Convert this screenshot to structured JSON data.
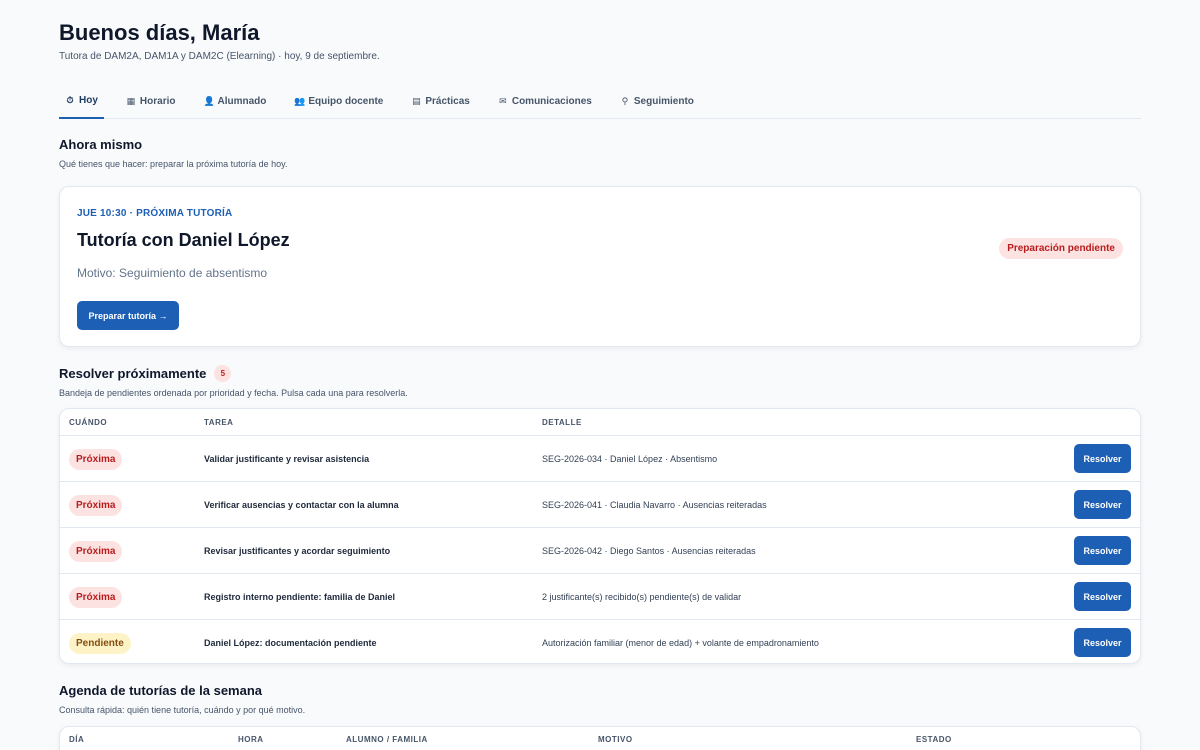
{
  "header": {
    "greeting": "Buenos días, María",
    "subtitle": "Tutora de DAM2A, DAM1A y DAM2C (Elearning) · hoy, 9 de septiembre."
  },
  "tabs": [
    {
      "label": "Hoy",
      "icon": "clock-icon",
      "glyph": "⏱",
      "active": true
    },
    {
      "label": "Horario",
      "icon": "calendar-icon",
      "glyph": "▦",
      "active": false
    },
    {
      "label": "Alumnado",
      "icon": "student-icon",
      "glyph": "👤",
      "active": false
    },
    {
      "label": "Equipo docente",
      "icon": "team-icon",
      "glyph": "👥",
      "active": false
    },
    {
      "label": "Prácticas",
      "icon": "building-icon",
      "glyph": "▤",
      "active": false
    },
    {
      "label": "Comunicaciones",
      "icon": "envelope-icon",
      "glyph": "✉",
      "active": false
    },
    {
      "label": "Seguimiento",
      "icon": "magnifier-icon",
      "glyph": "⚲",
      "active": false
    }
  ],
  "now": {
    "title": "Ahora mismo",
    "subtitle": "Qué tienes que hacer: preparar la próxima tutoría de hoy.",
    "eyebrow": "JUE 10:30 · PRÓXIMA TUTORÍA",
    "card_title": "Tutoría con Daniel López",
    "reason": "Motivo: Seguimiento de absentismo",
    "button": "Preparar tutoría →",
    "status": "Preparación pendiente"
  },
  "pending": {
    "title": "Resolver próximamente",
    "count": "5",
    "subtitle": "Bandeja de pendientes ordenada por prioridad y fecha. Pulsa cada una para resolverla.",
    "columns": {
      "when": "CUÁNDO",
      "task": "TAREA",
      "detail": "DETALLE"
    },
    "rows": [
      {
        "when": "Próxima",
        "kind": "proxima",
        "task": "Validar justificante y revisar asistencia",
        "detail": "SEG-2026-034 · Daniel López · Absentismo",
        "action": "Resolver"
      },
      {
        "when": "Próxima",
        "kind": "proxima",
        "task": "Verificar ausencias y contactar con la alumna",
        "detail": "SEG-2026-041 · Claudia Navarro · Ausencias reiteradas",
        "action": "Resolver"
      },
      {
        "when": "Próxima",
        "kind": "proxima",
        "task": "Revisar justificantes y acordar seguimiento",
        "detail": "SEG-2026-042 · Diego Santos · Ausencias reiteradas",
        "action": "Resolver"
      },
      {
        "when": "Próxima",
        "kind": "proxima",
        "task": "Registro interno pendiente: familia de Daniel",
        "detail": "2 justificante(s) recibido(s) pendiente(s) de validar",
        "action": "Resolver"
      },
      {
        "when": "Pendiente",
        "kind": "pendiente",
        "task": "Daniel López: documentación pendiente",
        "detail": "Autorización familiar (menor de edad) + volante de empadronamiento",
        "action": "Resolver"
      }
    ]
  },
  "agenda": {
    "title": "Agenda de tutorías de la semana",
    "subtitle": "Consulta rápida: quién tiene tutoría, cuándo y por qué motivo.",
    "columns": {
      "day": "DÍA",
      "time": "HORA",
      "student": "ALUMNO / FAMILIA",
      "reason": "MOTIVO",
      "status": "ESTADO"
    }
  }
}
